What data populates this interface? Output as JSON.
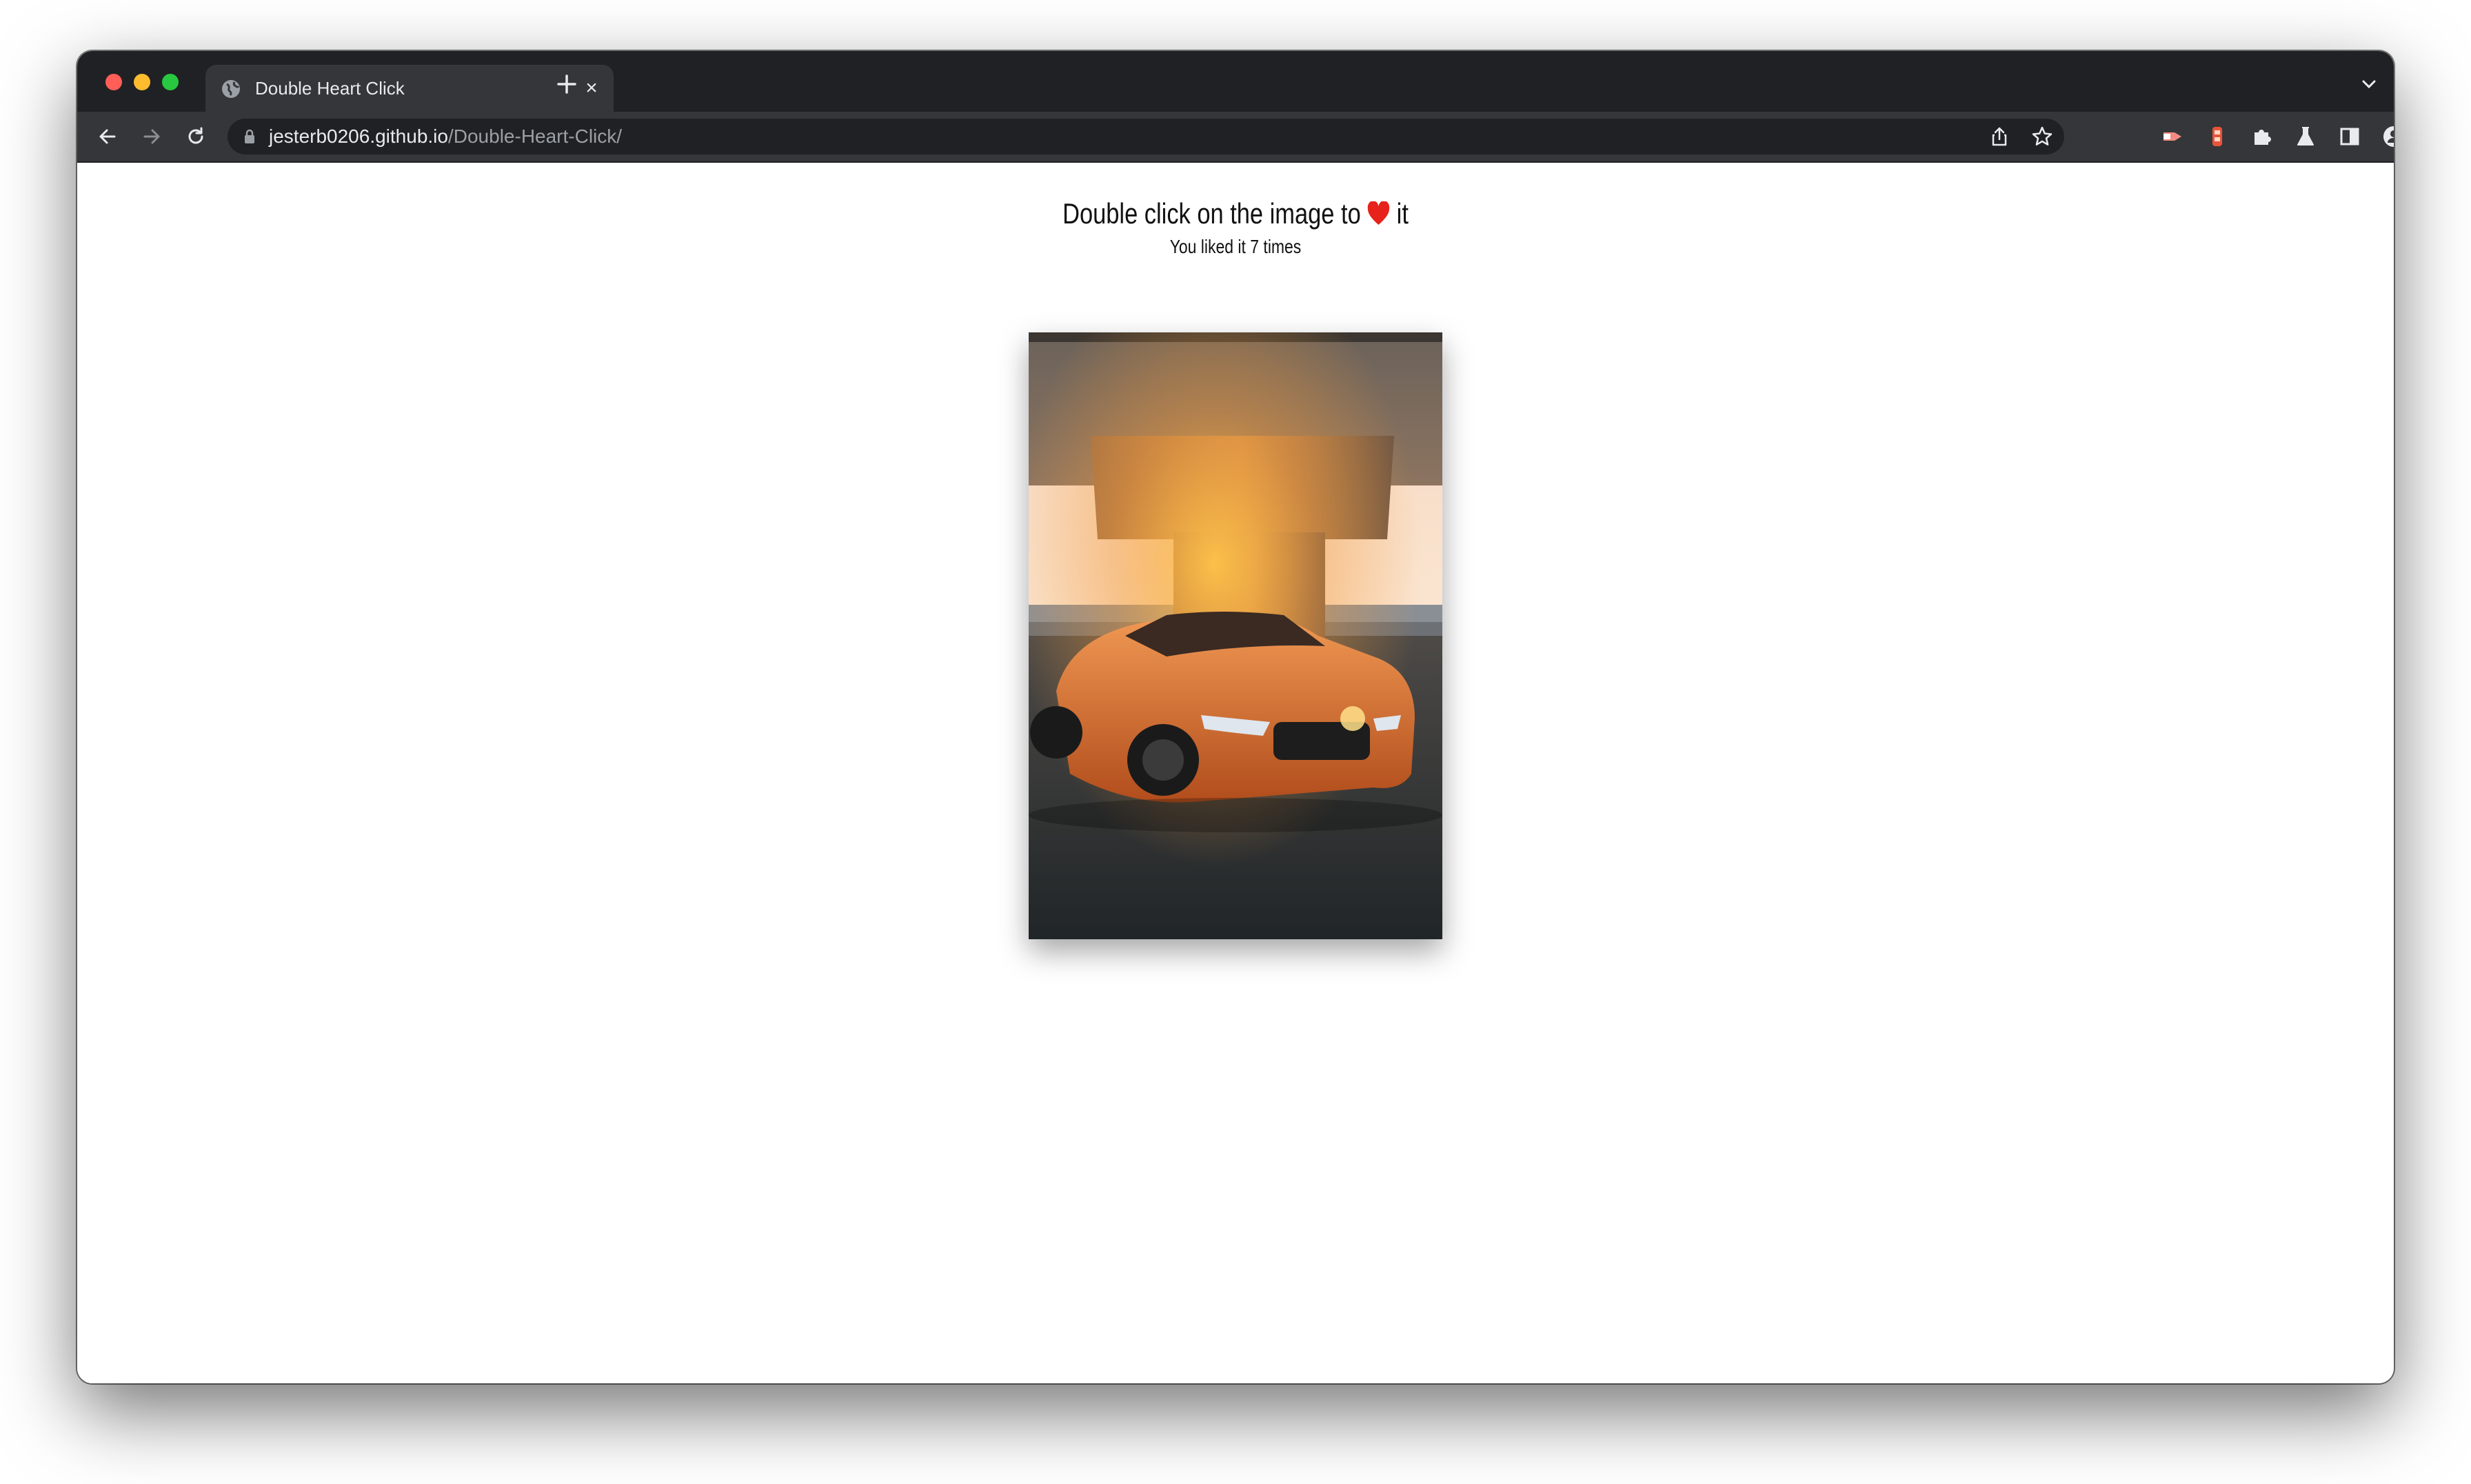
{
  "browser": {
    "tab_title": "Double Heart Click",
    "url_host": "jesterb0206.github.io",
    "url_path": "/Double-Heart-Click/"
  },
  "page": {
    "headline_prefix": "Double click on the image to",
    "headline_suffix": "it",
    "heart_icon": "heart-icon",
    "like_prefix": "You liked it",
    "like_count": "7",
    "like_suffix": "times"
  },
  "colors": {
    "heart": "#e6221b",
    "car": "#e07a2e",
    "tab_bar": "#202124",
    "toolbar": "#35363a"
  },
  "icons": [
    "globe-icon",
    "close-icon",
    "plus-icon",
    "chevron-down-icon",
    "back-arrow-icon",
    "forward-arrow-icon",
    "reload-icon",
    "lock-icon",
    "share-icon",
    "star-icon",
    "extension-icon",
    "puzzle-icon",
    "labs-flask-icon",
    "side-panel-icon",
    "profile-icon",
    "kebab-menu-icon"
  ]
}
